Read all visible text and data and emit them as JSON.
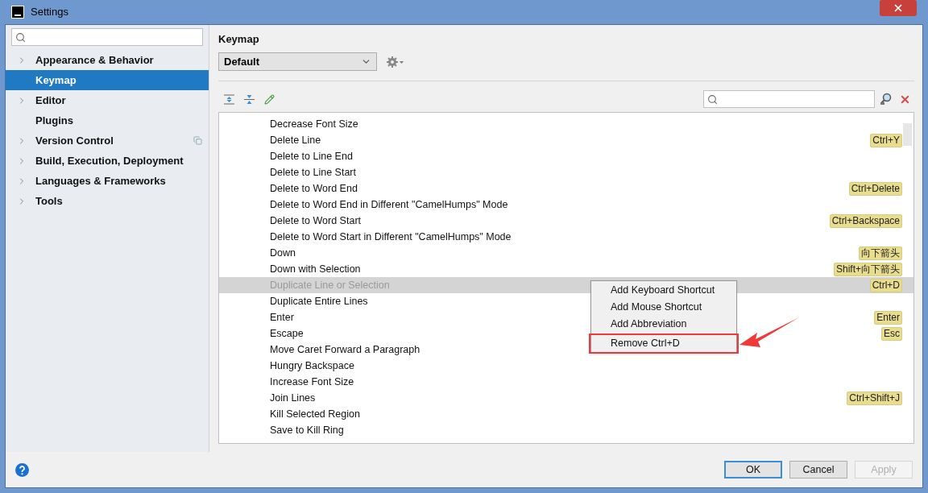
{
  "window": {
    "title": "Settings"
  },
  "sidebar": {
    "items": [
      {
        "label": "Appearance & Behavior",
        "expandable": true,
        "selected": false,
        "project_scoped": false
      },
      {
        "label": "Keymap",
        "expandable": false,
        "selected": true,
        "project_scoped": false
      },
      {
        "label": "Editor",
        "expandable": true,
        "selected": false,
        "project_scoped": false
      },
      {
        "label": "Plugins",
        "expandable": false,
        "selected": false,
        "project_scoped": false
      },
      {
        "label": "Version Control",
        "expandable": true,
        "selected": false,
        "project_scoped": true
      },
      {
        "label": "Build, Execution, Deployment",
        "expandable": true,
        "selected": false,
        "project_scoped": false
      },
      {
        "label": "Languages & Frameworks",
        "expandable": true,
        "selected": false,
        "project_scoped": false
      },
      {
        "label": "Tools",
        "expandable": true,
        "selected": false,
        "project_scoped": false
      }
    ]
  },
  "panel": {
    "title": "Keymap",
    "keymap_select": {
      "value": "Default"
    },
    "actions": [
      {
        "name": "Decrease Font Size",
        "selected": false
      },
      {
        "name": "Delete Line",
        "shortcut": "Ctrl+Y",
        "selected": false
      },
      {
        "name": "Delete to Line End",
        "selected": false
      },
      {
        "name": "Delete to Line Start",
        "selected": false
      },
      {
        "name": "Delete to Word End",
        "shortcut": "Ctrl+Delete",
        "selected": false
      },
      {
        "name": "Delete to Word End in Different \"CamelHumps\" Mode",
        "selected": false
      },
      {
        "name": "Delete to Word Start",
        "shortcut": "Ctrl+Backspace",
        "selected": false
      },
      {
        "name": "Delete to Word Start in Different \"CamelHumps\" Mode",
        "selected": false
      },
      {
        "name": "Down",
        "shortcut": "向下箭头",
        "selected": false
      },
      {
        "name": "Down with Selection",
        "shortcut": "Shift+向下箭头",
        "selected": false
      },
      {
        "name": "Duplicate Line or Selection",
        "shortcut": "Ctrl+D",
        "selected": true
      },
      {
        "name": "Duplicate Entire Lines",
        "selected": false
      },
      {
        "name": "Enter",
        "shortcut": "Enter",
        "selected": false
      },
      {
        "name": "Escape",
        "shortcut": "Esc",
        "selected": false
      },
      {
        "name": "Move Caret Forward a Paragraph",
        "selected": false
      },
      {
        "name": "Hungry Backspace",
        "selected": false
      },
      {
        "name": "Increase Font Size",
        "selected": false
      },
      {
        "name": "Join Lines",
        "shortcut": "Ctrl+Shift+J",
        "selected": false
      },
      {
        "name": "Kill Selected Region",
        "selected": false
      },
      {
        "name": "Save to Kill Ring",
        "selected": false
      }
    ],
    "context_menu": [
      {
        "label": "Add Keyboard Shortcut",
        "kind": "item",
        "annotated": false
      },
      {
        "label": "Add Mouse Shortcut",
        "kind": "item",
        "annotated": false
      },
      {
        "label": "Add Abbreviation",
        "kind": "item",
        "annotated": false
      },
      {
        "kind": "separator"
      },
      {
        "label": "Remove Ctrl+D",
        "kind": "item",
        "annotated": true
      }
    ]
  },
  "buttons": [
    {
      "label": "OK",
      "default": true,
      "disabled": false
    },
    {
      "label": "Cancel",
      "default": false,
      "disabled": false
    },
    {
      "label": "Apply",
      "default": false,
      "disabled": true
    }
  ]
}
